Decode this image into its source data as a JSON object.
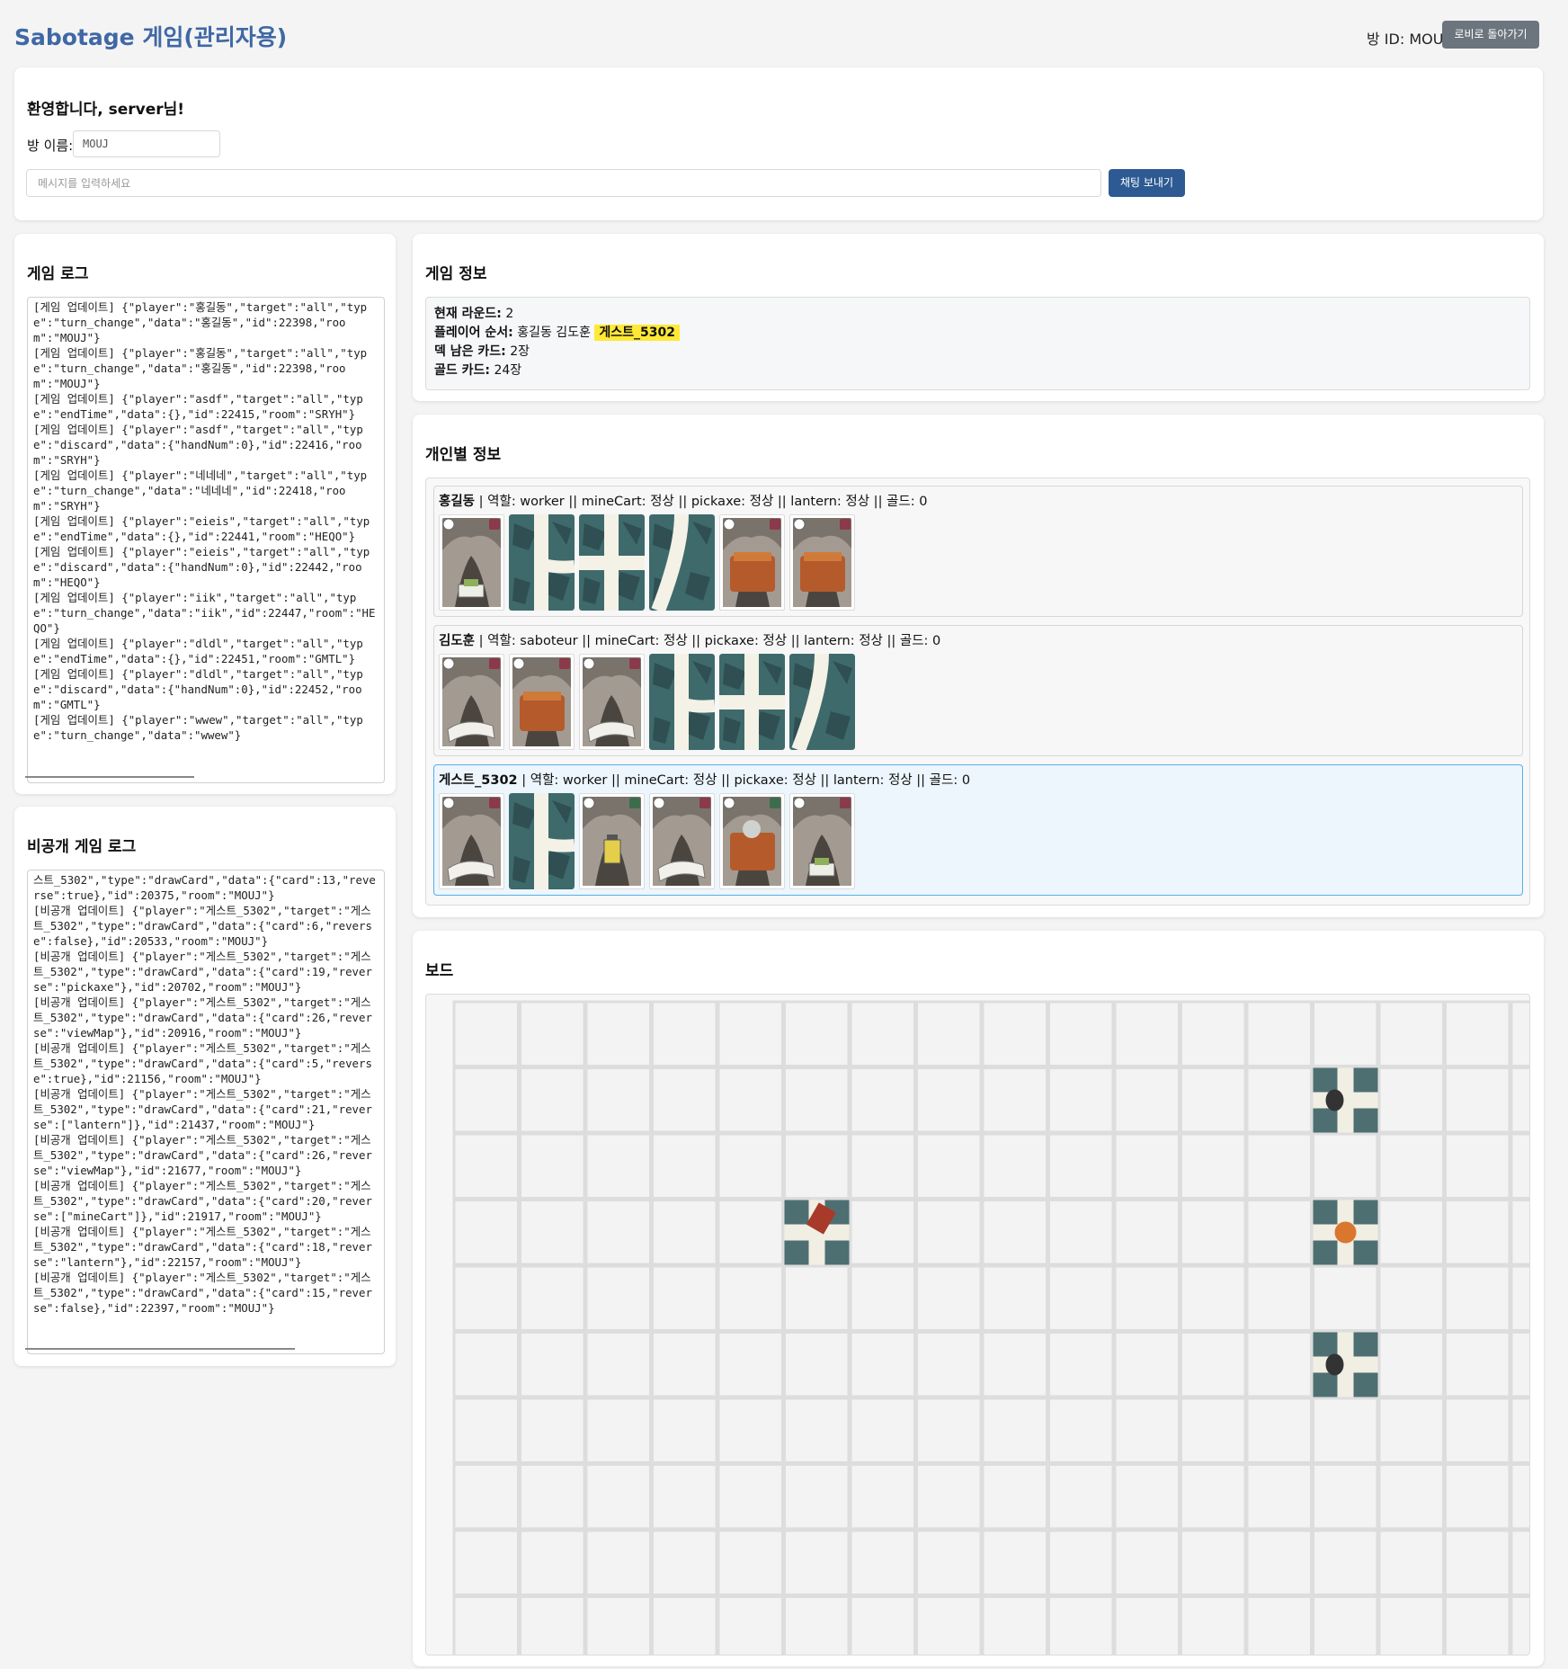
{
  "header": {
    "title": "Sabotage 게임(관리자용)",
    "room_id_label": "방 ID: MOUJ",
    "lobby_button": "로비로 돌아가기"
  },
  "top": {
    "welcome": "환영합니다, server님!",
    "room_name_label": "방 이름:",
    "room_name_value": "MOUJ",
    "chat_placeholder": "메시지를 입력하세요",
    "send_button": "채팅 보내기"
  },
  "game_log": {
    "title": "게임 로그",
    "lines": [
      "[게임 업데이트] {\"player\":\"홍길동\",\"target\":\"all\",\"type\":\"turn_change\",\"data\":\"홍길동\",\"id\":22398,\"room\":\"MOUJ\"}",
      "[게임 업데이트] {\"player\":\"홍길동\",\"target\":\"all\",\"type\":\"turn_change\",\"data\":\"홍길동\",\"id\":22398,\"room\":\"MOUJ\"}",
      "[게임 업데이트] {\"player\":\"asdf\",\"target\":\"all\",\"type\":\"endTime\",\"data\":{},\"id\":22415,\"room\":\"SRYH\"}",
      "[게임 업데이트] {\"player\":\"asdf\",\"target\":\"all\",\"type\":\"discard\",\"data\":{\"handNum\":0},\"id\":22416,\"room\":\"SRYH\"}",
      "[게임 업데이트] {\"player\":\"네네네\",\"target\":\"all\",\"type\":\"turn_change\",\"data\":\"네네네\",\"id\":22418,\"room\":\"SRYH\"}",
      "[게임 업데이트] {\"player\":\"eieis\",\"target\":\"all\",\"type\":\"endTime\",\"data\":{},\"id\":22441,\"room\":\"HEQO\"}",
      "[게임 업데이트] {\"player\":\"eieis\",\"target\":\"all\",\"type\":\"discard\",\"data\":{\"handNum\":0},\"id\":22442,\"room\":\"HEQO\"}",
      "[게임 업데이트] {\"player\":\"iik\",\"target\":\"all\",\"type\":\"turn_change\",\"data\":\"iik\",\"id\":22447,\"room\":\"HEQO\"}",
      "[게임 업데이트] {\"player\":\"dldl\",\"target\":\"all\",\"type\":\"endTime\",\"data\":{},\"id\":22451,\"room\":\"GMTL\"}",
      "[게임 업데이트] {\"player\":\"dldl\",\"target\":\"all\",\"type\":\"discard\",\"data\":{\"handNum\":0},\"id\":22452,\"room\":\"GMTL\"}",
      "[게임 업데이트] {\"player\":\"wwew\",\"target\":\"all\",\"type\":\"turn_change\",\"data\":\"wwew\"}"
    ]
  },
  "private_log": {
    "title": "비공개 게임 로그",
    "lines": [
      "스트_5302\",\"type\":\"drawCard\",\"data\":{\"card\":13,\"reverse\":true},\"id\":20375,\"room\":\"MOUJ\"}",
      "[비공개 업데이트] {\"player\":\"게스트_5302\",\"target\":\"게스트_5302\",\"type\":\"drawCard\",\"data\":{\"card\":6,\"reverse\":false},\"id\":20533,\"room\":\"MOUJ\"}",
      "[비공개 업데이트] {\"player\":\"게스트_5302\",\"target\":\"게스트_5302\",\"type\":\"drawCard\",\"data\":{\"card\":19,\"reverse\":\"pickaxe\"},\"id\":20702,\"room\":\"MOUJ\"}",
      "[비공개 업데이트] {\"player\":\"게스트_5302\",\"target\":\"게스트_5302\",\"type\":\"drawCard\",\"data\":{\"card\":26,\"reverse\":\"viewMap\"},\"id\":20916,\"room\":\"MOUJ\"}",
      "[비공개 업데이트] {\"player\":\"게스트_5302\",\"target\":\"게스트_5302\",\"type\":\"drawCard\",\"data\":{\"card\":5,\"reverse\":true},\"id\":21156,\"room\":\"MOUJ\"}",
      "[비공개 업데이트] {\"player\":\"게스트_5302\",\"target\":\"게스트_5302\",\"type\":\"drawCard\",\"data\":{\"card\":21,\"reverse\":[\"lantern\"]},\"id\":21437,\"room\":\"MOUJ\"}",
      "[비공개 업데이트] {\"player\":\"게스트_5302\",\"target\":\"게스트_5302\",\"type\":\"drawCard\",\"data\":{\"card\":26,\"reverse\":\"viewMap\"},\"id\":21677,\"room\":\"MOUJ\"}",
      "[비공개 업데이트] {\"player\":\"게스트_5302\",\"target\":\"게스트_5302\",\"type\":\"drawCard\",\"data\":{\"card\":20,\"reverse\":[\"mineCart\"]},\"id\":21917,\"room\":\"MOUJ\"}",
      "[비공개 업데이트] {\"player\":\"게스트_5302\",\"target\":\"게스트_5302\",\"type\":\"drawCard\",\"data\":{\"card\":18,\"reverse\":\"lantern\"},\"id\":22157,\"room\":\"MOUJ\"}",
      "[비공개 업데이트] {\"player\":\"게스트_5302\",\"target\":\"게스트_5302\",\"type\":\"drawCard\",\"data\":{\"card\":15,\"reverse\":false},\"id\":22397,\"room\":\"MOUJ\"}"
    ]
  },
  "game_info": {
    "title": "게임 정보",
    "round_label": "현재 라운드:",
    "round_value": "2",
    "order_label": "플레이어 순서:",
    "order_players": "홍길동 김도훈",
    "order_current": "게스트_5302",
    "deck_label": "덱 남은 카드:",
    "deck_value": "2장",
    "gold_label": "골드 카드:",
    "gold_value": "24장"
  },
  "players": {
    "title": "개인별 정보",
    "list": [
      {
        "name": "홍길동",
        "info": " | 역할: worker || mineCart: 정상 || pickaxe: 정상 || lantern: 정상 || 골드: 0",
        "cards": [
          "action-repair",
          "path-card",
          "path-card",
          "path-card",
          "action-break-cart",
          "action-break-cart"
        ]
      },
      {
        "name": "김도훈",
        "info": " | 역할: saboteur || mineCart: 정상 || pickaxe: 정상 || lantern: 정상 || 골드: 0",
        "cards": [
          "action-map",
          "action-break-cart",
          "action-map",
          "path-card",
          "path-card",
          "path-card"
        ]
      },
      {
        "name": "게스트_5302",
        "info": " | 역할: worker || mineCart: 정상 || pickaxe: 정상 || lantern: 정상 || 골드: 0",
        "cards": [
          "action-map",
          "path-card",
          "action-lantern",
          "action-map",
          "action-repair-cart",
          "action-repair"
        ]
      }
    ]
  },
  "board": {
    "title": "보드",
    "tiles": [
      "start-card",
      "goal-card",
      "goal-card",
      "goal-card"
    ]
  },
  "colors": {
    "title": "#3f68a5",
    "send_button": "#2d5a93",
    "lobby_button": "#6c757d",
    "highlight": "#ffe936",
    "current_player_border": "#56aee8"
  }
}
